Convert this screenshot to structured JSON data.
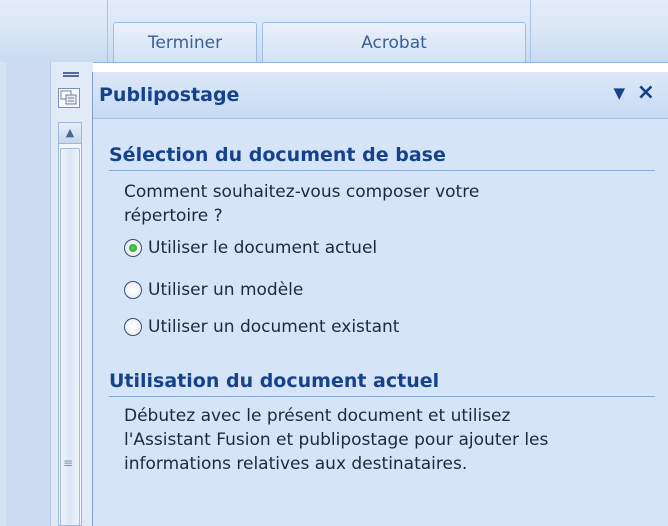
{
  "ribbon": {
    "tabs": [
      {
        "label": "Terminer"
      },
      {
        "label": "Acrobat"
      }
    ]
  },
  "pane": {
    "title": "Publipostage",
    "menu_glyph": "▼",
    "close_glyph": "×",
    "section1": {
      "title": "Sélection du document de base",
      "question_line1": "Comment souhaitez-vous composer votre",
      "question_line2": "répertoire ?",
      "options": [
        {
          "label": "Utiliser le document actuel",
          "checked": true
        },
        {
          "label": "Utiliser un modèle",
          "checked": false
        },
        {
          "label": "Utiliser un document existant",
          "checked": false
        }
      ]
    },
    "section2": {
      "title": "Utilisation du document actuel",
      "line1": "Débutez avec le présent document et utilisez",
      "line2": "l'Assistant Fusion et publipostage pour ajouter les",
      "line3": "informations relatives aux destinataires."
    }
  },
  "scrollbar": {
    "up_arrow": "▲",
    "grip": "≡"
  },
  "colors": {
    "accent": "#15428b",
    "pane_bg": "#d5e4f7",
    "ribbon_text": "#3b5f95",
    "radio_selected": "#1e9b1e"
  },
  "icons": [
    "pane-icon",
    "dropdown-arrow-icon",
    "close-icon",
    "scroll-up-arrow-icon",
    "scroll-grip-icon"
  ]
}
